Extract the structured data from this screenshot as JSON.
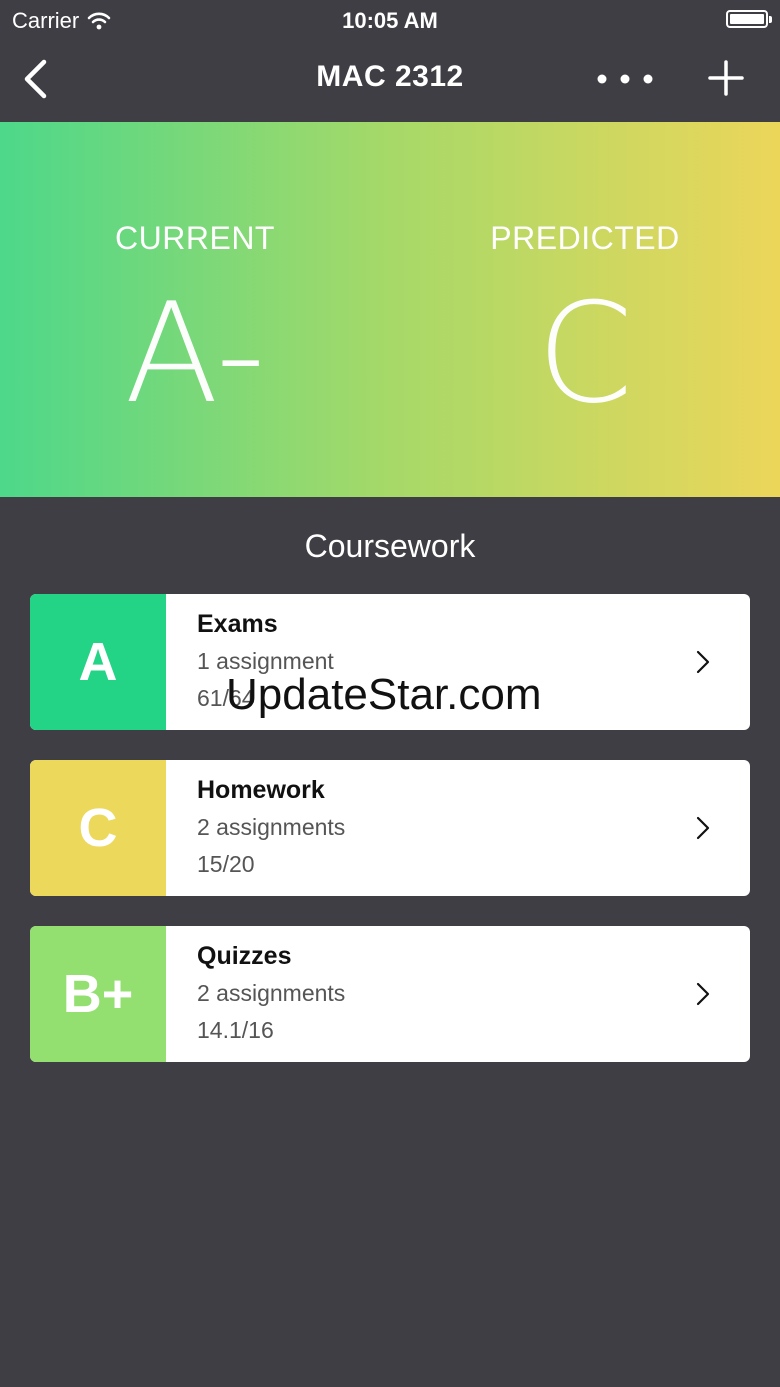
{
  "status_bar": {
    "carrier": "Carrier",
    "time": "10:05 AM",
    "wifi_icon": "wifi-icon",
    "battery_icon": "battery-icon"
  },
  "nav": {
    "title": "MAC 2312",
    "back_icon": "chevron-left-icon",
    "more_icon": "ellipsis-icon",
    "add_icon": "plus-icon"
  },
  "grades": {
    "current_label": "CURRENT",
    "current_value": "A-",
    "predicted_label": "PREDICTED",
    "predicted_value": "C",
    "gradient_start": "#4dd88a",
    "gradient_end": "#ecd65a"
  },
  "coursework": {
    "title": "Coursework",
    "items": [
      {
        "grade": "A",
        "name": "Exams",
        "count": "1 assignment",
        "score": "61/64",
        "color": "#24d486"
      },
      {
        "grade": "C",
        "name": "Homework",
        "count": "2 assignments",
        "score": "15/20",
        "color": "#ecd85a"
      },
      {
        "grade": "B+",
        "name": "Quizzes",
        "count": "2 assignments",
        "score": "14.1/16",
        "color": "#93e070"
      }
    ]
  },
  "watermark": "UpdateStar.com",
  "colors": {
    "background": "#3f3e44",
    "card": "#ffffff"
  }
}
